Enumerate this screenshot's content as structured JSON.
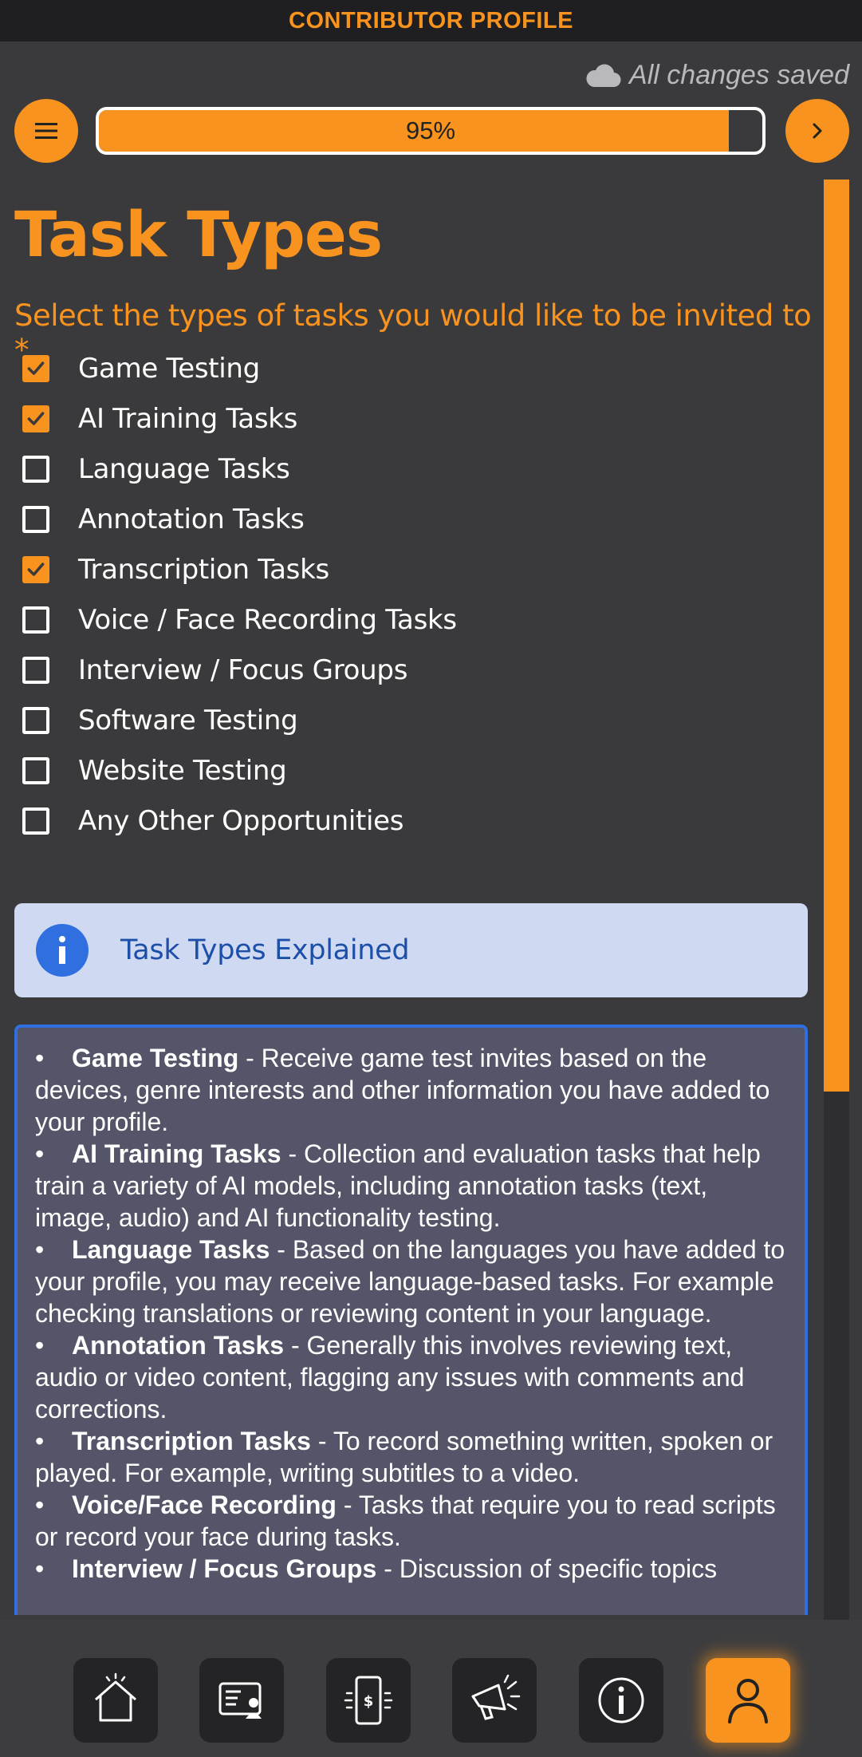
{
  "header": {
    "title": "CONTRIBUTOR PROFILE"
  },
  "status": {
    "saved_text": "All changes saved",
    "icon": "cloud-icon"
  },
  "progress": {
    "label": "95%",
    "value": 0.95
  },
  "page": {
    "title": "Task Types",
    "question": "Select the types of tasks you would like to be invited to *"
  },
  "options": [
    {
      "label": "Game Testing",
      "checked": true
    },
    {
      "label": "AI Training Tasks",
      "checked": true
    },
    {
      "label": "Language Tasks",
      "checked": false
    },
    {
      "label": "Annotation Tasks",
      "checked": false
    },
    {
      "label": "Transcription Tasks",
      "checked": true
    },
    {
      "label": "Voice / Face Recording Tasks",
      "checked": false
    },
    {
      "label": "Interview / Focus Groups",
      "checked": false
    },
    {
      "label": "Software Testing",
      "checked": false
    },
    {
      "label": "Website Testing",
      "checked": false
    },
    {
      "label": "Any Other Opportunities",
      "checked": false
    }
  ],
  "info": {
    "label": "Task Types Explained"
  },
  "explanations": [
    {
      "term": "Game Testing",
      "text": " - Receive game test invites based on the devices, genre interests and other information you have added to your profile."
    },
    {
      "term": "AI Training Tasks",
      "text": " - Collection and evaluation tasks that help train a variety of AI models, including annotation tasks (text, image, audio) and AI functionality testing."
    },
    {
      "term": "Language Tasks",
      "text": " - Based on the languages you have added to your profile, you may receive language-based tasks. For example checking translations or reviewing content in your language."
    },
    {
      "term": "Annotation Tasks",
      "text": " - Generally this involves reviewing text, audio or video content, flagging any issues with comments and corrections."
    },
    {
      "term": "Transcription Tasks",
      "text": " - To record something written, spoken or played. For example, writing subtitles to a video."
    },
    {
      "term": "Voice/Face Recording",
      "text": " - Tasks that require you to read scripts or record your face during tasks."
    },
    {
      "term": "Interview / Focus Groups",
      "text": " - Discussion of specific topics"
    }
  ],
  "nav": [
    {
      "icon": "home-icon",
      "active": false
    },
    {
      "icon": "profile-card-icon",
      "active": false
    },
    {
      "icon": "payment-phone-icon",
      "active": false
    },
    {
      "icon": "megaphone-icon",
      "active": false
    },
    {
      "icon": "info-icon",
      "active": false
    },
    {
      "icon": "user-icon",
      "active": true
    }
  ],
  "colors": {
    "accent": "#f7931e",
    "background": "#3a3a3c",
    "info_blue": "#2f6fe0"
  }
}
